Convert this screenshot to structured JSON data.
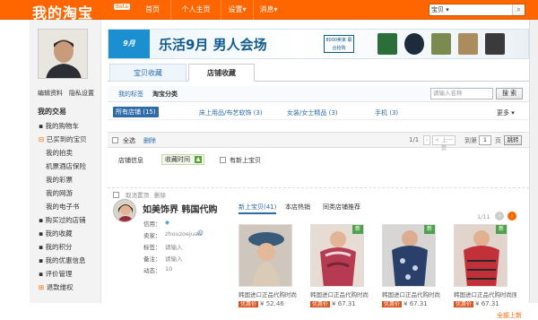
{
  "header": {
    "logo": "我的淘宝",
    "beta": "Beta",
    "nav": [
      "首页",
      "个人主页",
      "设置▾",
      "消息▾"
    ],
    "search_scope": "宝贝",
    "search_placeholder": ""
  },
  "sidebar": {
    "links": [
      "编辑资料",
      "隐私设置"
    ],
    "section_title": "我的交易",
    "items": [
      "我的购物车",
      "已买到的宝贝",
      "我的拍卖",
      "机票酒店保险",
      "我的彩票",
      "我的网游",
      "我的电子书",
      "购买过的店铺",
      "我的收藏",
      "我的积分",
      "我的优惠信息",
      "评价管理",
      "退款维权"
    ],
    "item_icons": [
      "bullet",
      "minus-box",
      "bullet",
      "bullet",
      "bullet",
      "bullet",
      "bullet",
      "bullet",
      "bullet",
      "bullet",
      "bullet",
      "bullet",
      "plus-box"
    ]
  },
  "banner": {
    "logo": "9月",
    "headline": "乐活9月 男人会场",
    "badge": "8000卖家 联合抢购"
  },
  "tabs": {
    "items": [
      "宝贝收藏",
      "店铺收藏"
    ],
    "active": 1
  },
  "filter": {
    "subtabs": [
      "我的标签",
      "淘宝分类"
    ],
    "search_placeholder": "请输入名称",
    "search_button": "搜 索"
  },
  "categories": {
    "items": [
      "所有店铺 (15)",
      "床上用品/布艺软饰 (3)",
      "女装/女士精品 (3)",
      "手机 (3)"
    ],
    "more": "更多 ▾"
  },
  "toolbar": {
    "select_all": "全选",
    "delete": "删除",
    "page_info": "1/1",
    "prev": "< 上一页",
    "next": "下一页 >",
    "goto_label": "到第",
    "page_value": "1",
    "page_unit": "页",
    "go": "跳转"
  },
  "sort": {
    "label": "店铺信息",
    "sort_button": "收藏时间",
    "online_filter": "有新上宝贝"
  },
  "shop": {
    "actions": [
      "取消置顶",
      "删除"
    ],
    "name": "如美饰界 韩国代购",
    "credit_label": "信用：",
    "seller_label": "卖家：",
    "seller_value": "zhouzoejuan",
    "tag_label": "标签：",
    "tag_value": "请输入",
    "note_label": "备注：",
    "note_value": "请输入",
    "activity_label": "动态：",
    "activity_value": "10",
    "product_tabs": [
      "新上宝贝(41)",
      "本店热销",
      "同类店铺推荐"
    ],
    "page_indicator": "1/11",
    "products": [
      {
        "desc": "韩国进口正品代购时尚",
        "tag": "优惠价",
        "price": "¥ 52.46"
      },
      {
        "desc": "韩国进口正品代购时尚",
        "tag": "优惠价",
        "price": "¥ 67.31"
      },
      {
        "desc": "韩国进口正品代购时尚",
        "tag": "优惠价",
        "price": "¥ 67.31"
      },
      {
        "desc": "韩国进口正品代购时尚围",
        "tag": "优惠价",
        "price": "¥ 67.31"
      }
    ],
    "new_badge": "新",
    "more": "全部上新"
  },
  "colors": {
    "brand": "#ff6600",
    "link": "#2c6aa8",
    "price_tag": "#d9531e"
  }
}
